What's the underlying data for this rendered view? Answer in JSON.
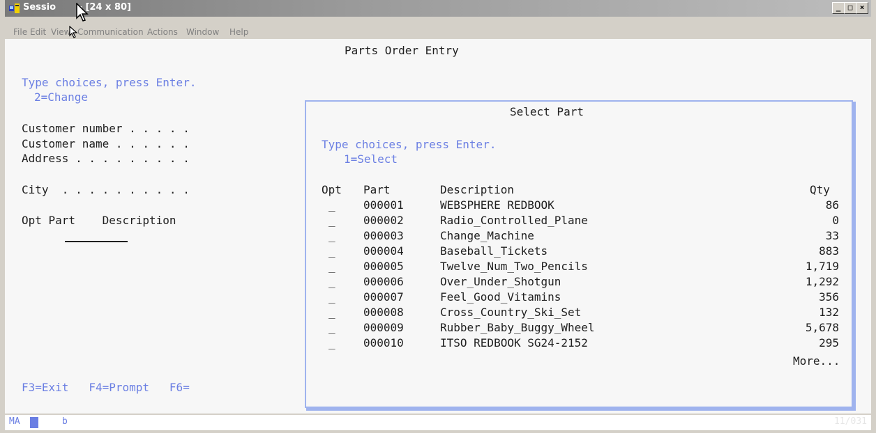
{
  "window": {
    "title": "Session B - [24 x 80]",
    "title_left": "Sessio",
    "title_right": " - [24 x 80]",
    "btn_min": "_",
    "btn_max": "□",
    "btn_close": "×"
  },
  "menu": [
    "File",
    "Edit",
    "View",
    "Communication",
    "Actions",
    "Window",
    "Help"
  ],
  "screen": {
    "title": "Parts Order Entry",
    "instructions": "Type choices, press Enter.",
    "option_hint": "2=Change",
    "labels": {
      "customer_number": "Customer number . . . . .",
      "customer_name": "Customer name . . . . . .",
      "address": "Address . . . . . . . . .",
      "city": "City  . . . . . . . . . ."
    },
    "list_header": "Opt Part    Description",
    "function_keys": "F3=Exit   F4=Prompt   F6="
  },
  "popup": {
    "title": "Select Part",
    "instructions": "Type choices, press Enter.",
    "option_hint": "1=Select",
    "headers": {
      "opt": "Opt",
      "part": "Part",
      "description": "Description",
      "qty": "Qty"
    },
    "rows": [
      {
        "opt": "_",
        "part": "000001",
        "description": "WEBSPHERE REDBOOK",
        "qty": "86"
      },
      {
        "opt": "_",
        "part": "000002",
        "description": "Radio_Controlled_Plane",
        "qty": "0"
      },
      {
        "opt": "_",
        "part": "000003",
        "description": "Change_Machine",
        "qty": "33"
      },
      {
        "opt": "_",
        "part": "000004",
        "description": "Baseball_Tickets",
        "qty": "883"
      },
      {
        "opt": "_",
        "part": "000005",
        "description": "Twelve_Num_Two_Pencils",
        "qty": "1,719"
      },
      {
        "opt": "_",
        "part": "000006",
        "description": "Over_Under_Shotgun",
        "qty": "1,292"
      },
      {
        "opt": "_",
        "part": "000007",
        "description": "Feel_Good_Vitamins",
        "qty": "356"
      },
      {
        "opt": "_",
        "part": "000008",
        "description": "Cross_Country_Ski_Set",
        "qty": "132"
      },
      {
        "opt": "_",
        "part": "000009",
        "description": "Rubber_Baby_Buggy_Wheel",
        "qty": "5,678"
      },
      {
        "opt": "_",
        "part": "000010",
        "description": "ITSO REDBOOK SG24-2152",
        "qty": "295"
      }
    ],
    "more": "More..."
  },
  "status": {
    "mode": "MA",
    "b": "b",
    "position": "11/031"
  },
  "colors": {
    "field_text": "#202020",
    "highlight_blue": "#6b7fe3",
    "popup_border": "#9fb3ee",
    "screen_bg": "#f7f7f7"
  }
}
